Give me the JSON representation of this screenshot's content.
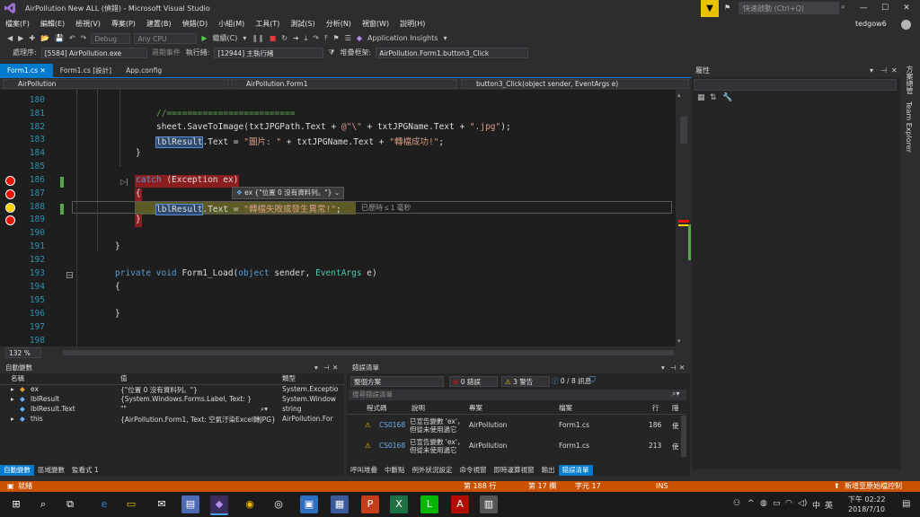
{
  "window": {
    "title": "AirPollution New ALL (偵錯) - Microsoft Visual Studio",
    "quick_launch_placeholder": "快速啟動 (Ctrl+Q)",
    "user": "tedgow6"
  },
  "menu": [
    "檔案(F)",
    "編輯(E)",
    "檢視(V)",
    "專案(P)",
    "建置(B)",
    "偵錯(D)",
    "小組(M)",
    "工具(T)",
    "測試(S)",
    "分析(N)",
    "視窗(W)",
    "說明(H)"
  ],
  "toolbar": {
    "config": "Debug",
    "platform": "Any CPU",
    "continue_label": "繼續(C)",
    "app_insights": "Application Insights",
    "process_label": "處理序:",
    "process_value": "[5584] AirPollution.exe",
    "lifecycle_label": "週期事件",
    "thread_label": "執行緒:",
    "thread_value": "[12944] 主執行緒",
    "stackframe_label": "堆疊框架:",
    "stackframe_value": "AirPollution.Form1.button3_Click"
  },
  "doc_tabs": [
    "Form1.cs",
    "Form1.cs [設計]",
    "App.config"
  ],
  "nav": {
    "project": "AirPollution",
    "class": "AirPollution.Form1",
    "member": "button3_Click(object sender, EventArgs e)"
  },
  "editor": {
    "line_numbers": [
      "180",
      "181",
      "182",
      "183",
      "184",
      "185",
      "186",
      "187",
      "188",
      "189",
      "190",
      "191",
      "192",
      "193",
      "194",
      "195",
      "196",
      "197",
      "198"
    ],
    "code": {
      "l181": "//=========================",
      "l182_a": "sheet.SaveToImage(txtJPGPath.Text + ",
      "l182_b": "@\"\\\"",
      "l182_c": " + txtJPGName.Text + ",
      "l182_d": "\".jpg\"",
      "l182_e": ");",
      "l183_var": "lblResult",
      "l183_a": ".Text = ",
      "l183_b": "\"圖片: \"",
      "l183_c": " + txtJPGName.Text + ",
      "l183_d": "\"轉檔成功!\"",
      "l183_e": ";",
      "l184": "}",
      "l186_kw": "catch",
      "l186_rest": " (Exception ex)",
      "l187": "{",
      "l188_var": "lblResult",
      "l188_a": ".Text = ",
      "l188_b": "\"轉檔失敗或發生異常!\"",
      "l188_c": ";",
      "l189": "}",
      "l191": "}",
      "l193_kw": "private void",
      "l193_name": " Form1_Load(",
      "l193_obj": "object",
      "l193_mid": " sender, ",
      "l193_type": "EventArgs",
      "l193_end": " e)",
      "l194": "{",
      "l196": "}"
    },
    "datatip": "ex {\"位置 0 沒有資料列。\"}",
    "perftip": "已歷時 ≤ 1 毫秒",
    "zoom": "132 %"
  },
  "properties": {
    "title": "屬性"
  },
  "sidestrip": [
    "方案總管",
    "Team Explorer"
  ],
  "autos": {
    "title": "自動變數",
    "columns": [
      "名稱",
      "值",
      "類型"
    ],
    "rows": [
      {
        "name": "ex",
        "value": "{\"位置 0 沒有資料列。\"}",
        "type": "System.Exceptio"
      },
      {
        "name": "lblResult",
        "value": "{System.Windows.Forms.Label, Text: }",
        "type": "System.Window"
      },
      {
        "name": "lblResult.Text",
        "value": "\"\"",
        "type": "string"
      },
      {
        "name": "this",
        "value": "{AirPollution.Form1, Text: 空氣汙染Excel轉JPG}",
        "type": "AirPollution.For"
      }
    ],
    "tabs": [
      "自動變數",
      "區域變數",
      "監看式 1"
    ]
  },
  "errors": {
    "title": "錯誤清單",
    "scope": "整個方案",
    "errors_label": "0 錯誤",
    "warnings_label": "3 警告",
    "messages_label": "0 / 8 訊息",
    "search_placeholder": "搜尋錯誤清單",
    "columns": [
      "程式碼",
      "說明",
      "專案",
      "檔案",
      "行",
      "隱"
    ],
    "rows": [
      {
        "code": "CS0168",
        "desc1": "已宣告變數 'ex'，",
        "desc2": "但從未使用過它",
        "project": "AirPollution",
        "file": "Form1.cs",
        "line": "186",
        "supp": "使"
      },
      {
        "code": "CS0168",
        "desc1": "已宣告變數 'ex'，",
        "desc2": "但從未使用過它",
        "project": "AirPollution",
        "file": "Form1.cs",
        "line": "213",
        "supp": "使"
      }
    ],
    "tabs": [
      "呼叫堆疊",
      "中斷點",
      "例外狀況設定",
      "命令視窗",
      "即時運算視窗",
      "輸出",
      "錯誤清單"
    ]
  },
  "status": {
    "ready": "就緒",
    "row": "第 188 行",
    "col": "第 17 欄",
    "char": "字元 17",
    "ins": "INS",
    "source_control": "新增至原始檔控制"
  },
  "taskbar": {
    "time": "下午 02:22",
    "date": "2018/7/10",
    "ime": "中",
    "lang": "英"
  },
  "colors": {
    "accent": "#007acc",
    "status_debug": "#ca5100",
    "breakpoint": "#e51400"
  }
}
